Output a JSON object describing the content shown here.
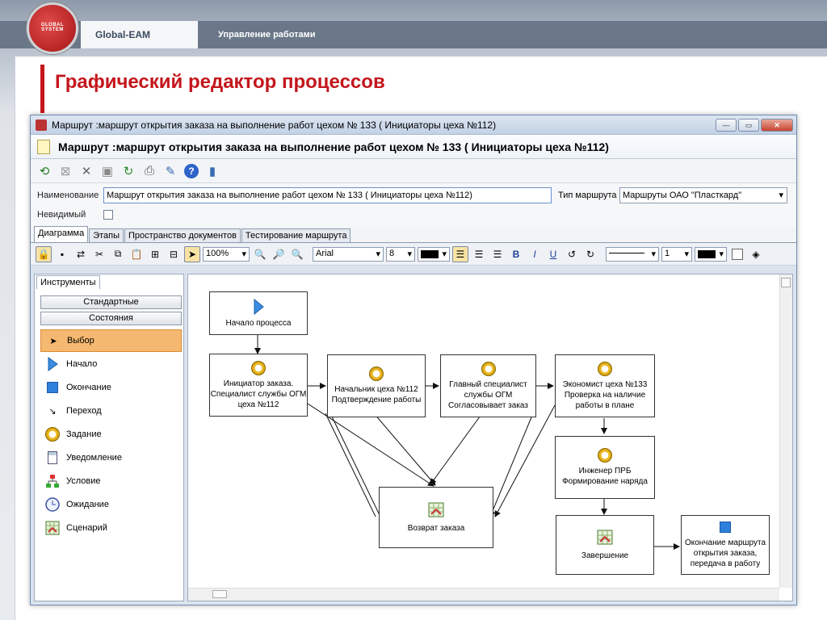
{
  "slide": {
    "logo_text": "GLOBAL SYSTEM",
    "tab_eam": "Global-EAM",
    "tab_work": "Управление работами",
    "title": "Графический редактор процессов"
  },
  "window": {
    "title": "Маршрут :маршрут открытия заказа на выполнение работ цехом № 133 ( Инициаторы цеха №112)",
    "header": "Маршрут :маршрут открытия заказа на выполнение работ цехом № 133 ( Инициаторы цеха №112)",
    "buttons": {
      "minimize": "—",
      "maximize": "▭",
      "close": "✕"
    }
  },
  "props": {
    "name_label": "Наименование",
    "name_value": "Маршрут открытия заказа на выполнение работ цехом № 133 ( Инициаторы цеха №112)",
    "type_label": "Тип маршрута",
    "type_value": "Маршруты ОАО \"Пласткард\"",
    "invisible_label": "Невидимый"
  },
  "tabs": [
    "Диаграмма",
    "Этапы",
    "Пространство документов",
    "Тестирование маршрута"
  ],
  "toolbar2": {
    "zoom": "100%",
    "font": "Arial",
    "size": "8",
    "line_width": "1"
  },
  "tools": {
    "tab_label": "Инструменты",
    "btn_standard": "Стандартные",
    "btn_states": "Состояния",
    "items": [
      "Выбор",
      "Начало",
      "Окончание",
      "Переход",
      "Задание",
      "Уведомление",
      "Условие",
      "Ожидание",
      "Сценарий"
    ]
  },
  "nodes": {
    "start": "Начало процесса",
    "initiator": [
      "Инициатор заказа.",
      "Специалист службы ОГМ",
      "цеха №112"
    ],
    "chief": [
      "Начальник цеха №112",
      "Подтверждение работы"
    ],
    "main_spec": [
      "Главный специалист",
      "службы ОГМ",
      "Согласовывает заказ"
    ],
    "economist": [
      "Экономист цеха №133",
      "Проверка на наличие",
      "работы в плане"
    ],
    "engineer": [
      "Инженер ПРБ",
      "Формирование наряда"
    ],
    "return": "Возврат заказа",
    "finish": "Завершение",
    "end": [
      "Окончание маршрута",
      "открытия заказа,",
      "передача в работу"
    ]
  },
  "colors": {
    "accent_red": "#c4161c",
    "selected_tool": "#f5b871"
  }
}
